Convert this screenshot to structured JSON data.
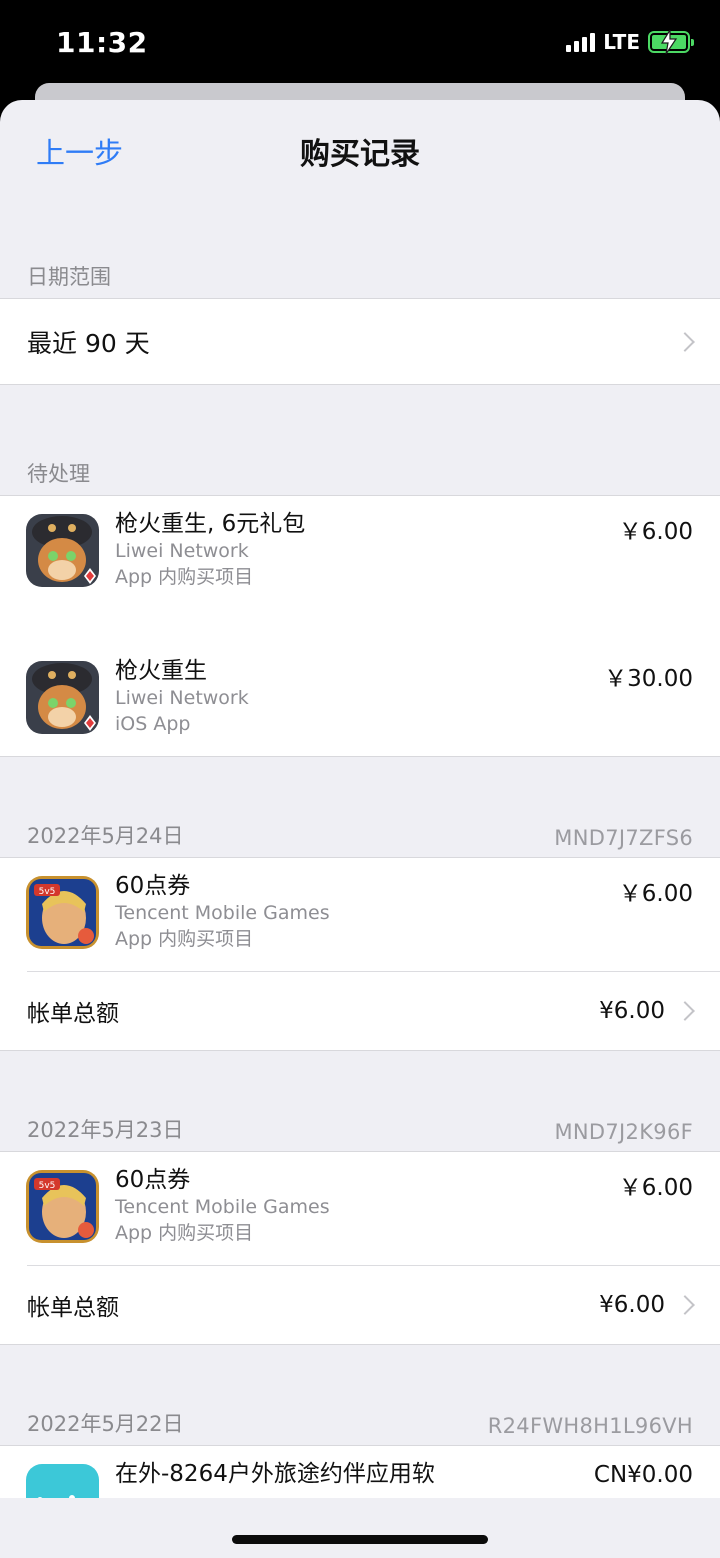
{
  "status": {
    "time": "11:32",
    "network": "LTE"
  },
  "nav": {
    "back": "上一步",
    "title": "购买记录"
  },
  "date_range": {
    "header": "日期范围",
    "value": "最近 90 天"
  },
  "pending": {
    "header": "待处理",
    "items": [
      {
        "name": "枪火重生, 6元礼包",
        "developer": "Liwei Network",
        "kind": "App 内购买项目",
        "price": "￥6.00",
        "icon": "gunfire-reborn-icon"
      },
      {
        "name": "枪火重生",
        "developer": "Liwei Network",
        "kind": "iOS App",
        "price": "￥30.00",
        "icon": "gunfire-reborn-icon"
      }
    ]
  },
  "orders": [
    {
      "date": "2022年5月24日",
      "order_id": "MND7J7ZFS6",
      "item": {
        "name": "60点券",
        "developer": "Tencent Mobile Games",
        "kind": "App 内购买项目",
        "price": "￥6.00",
        "icon": "honor-of-kings-icon"
      },
      "total_label": "帐单总额",
      "total": "¥6.00"
    },
    {
      "date": "2022年5月23日",
      "order_id": "MND7J2K96F",
      "item": {
        "name": "60点券",
        "developer": "Tencent Mobile Games",
        "kind": "App 内购买项目",
        "price": "￥6.00",
        "icon": "honor-of-kings-icon"
      },
      "total_label": "帐单总额",
      "total": "¥6.00"
    },
    {
      "date": "2022年5月22日",
      "order_id": "R24FWH8H1L96VH",
      "item": {
        "name": "在外-8264户外旅途约伴应用软",
        "price": "CN¥0.00",
        "icon": "zaiwai-app-icon"
      }
    }
  ],
  "colors": {
    "accent": "#2f7cf6",
    "background": "#efeff4",
    "battery": "#4cd964"
  }
}
